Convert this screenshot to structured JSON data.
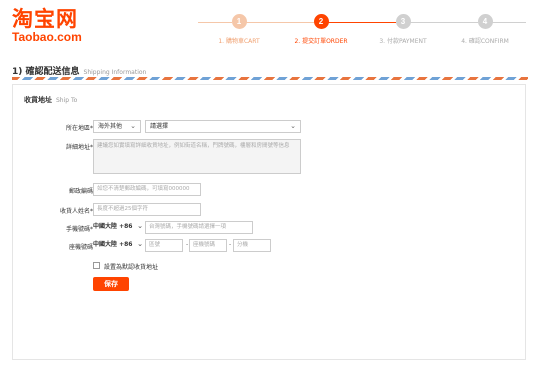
{
  "brand": {
    "name_cn": "淘宝网",
    "name_en": "Taobao.com"
  },
  "steps": [
    {
      "num": "1",
      "label": "1. 購物車CART",
      "state": "done"
    },
    {
      "num": "2",
      "label": "2. 提交訂單ORDER",
      "state": "active"
    },
    {
      "num": "3",
      "label": "3. 付款PAYMENT",
      "state": "todo"
    },
    {
      "num": "4",
      "label": "4. 確認CONFIRM",
      "state": "todo"
    }
  ],
  "colors": {
    "accent": "#ff4400",
    "step_done": "#f5c7a9",
    "step_todo": "#d0d0d0",
    "border": "#cccccc"
  },
  "section": {
    "title": "1) 確認配送信息",
    "subtitle": "Shipping Information"
  },
  "form": {
    "title": "收貨地址",
    "title_en": "Ship To",
    "region": {
      "label": "所在地區",
      "country": "海外其他",
      "area": "請選擇"
    },
    "address": {
      "label": "詳細地址",
      "placeholder": "建議您如實填寫詳細收貨地址，例如街道名稱，門牌號碼，樓層和房間號等信息"
    },
    "postcode": {
      "label": "郵政編碼",
      "placeholder": "如您不清楚郵政編碼，可填寫000000"
    },
    "recipient": {
      "label": "收貨人姓名",
      "placeholder": "長度不超過25個字符"
    },
    "mobile": {
      "label": "手機號碼",
      "country": "中國大陸 +86",
      "placeholder": "台灣號碼，手機號碼請選擇一項"
    },
    "phone": {
      "label": "座機號碼",
      "country": "中國大陸 +86",
      "area_placeholder": "區號",
      "number_placeholder": "座機號碼",
      "ext_placeholder": "分機",
      "sep": "-"
    },
    "default_checkbox": {
      "label": "設置為默認收貨地址",
      "checked": false
    },
    "save_label": "保存"
  }
}
